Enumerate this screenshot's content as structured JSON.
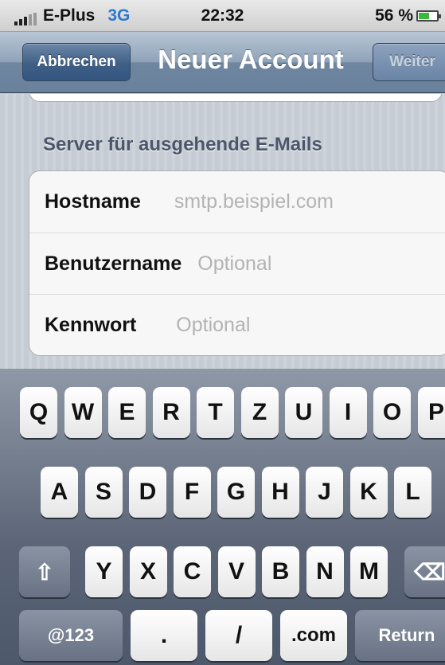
{
  "status_bar": {
    "carrier": "E-Plus",
    "network": "3G",
    "time": "22:32",
    "battery": "56 %",
    "battery_level": 0.56,
    "battery_color": "#3bb83b"
  },
  "nav_bar": {
    "cancel_label": "Abbrechen",
    "title": "Neuer Account",
    "next_label": "Weiter"
  },
  "section": {
    "title": "Server für ausgehende E-Mails"
  },
  "fields": [
    {
      "label": "Hostname",
      "placeholder": "smtp.beispiel.com"
    },
    {
      "label": "Benutzername",
      "placeholder": "Optional"
    },
    {
      "label": "Kennwort",
      "placeholder": "Optional"
    }
  ],
  "keyboard": {
    "row1": [
      "Q",
      "W",
      "E",
      "R",
      "T",
      "Z",
      "U",
      "I",
      "O",
      "P"
    ],
    "row2": [
      "A",
      "S",
      "D",
      "F",
      "G",
      "H",
      "J",
      "K",
      "L"
    ],
    "row3": [
      "Y",
      "X",
      "C",
      "V",
      "B",
      "N",
      "M"
    ],
    "shift_icon": "⇧",
    "delete_icon": "⌫",
    "numbers_label": "@123",
    "dot_label": ".",
    "slash_label": "/",
    "com_label": ".com",
    "return_label": "Return"
  }
}
